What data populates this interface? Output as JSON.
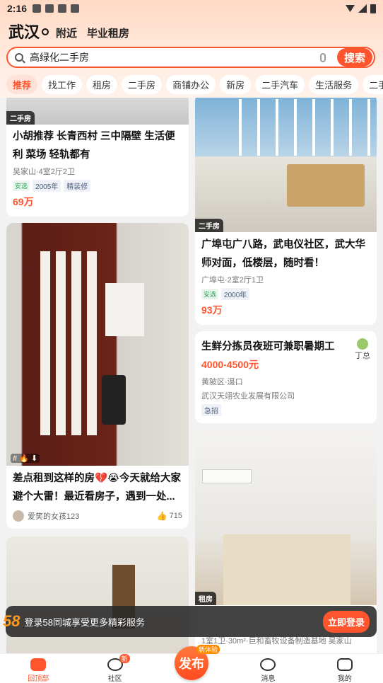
{
  "status_bar": {
    "time": "2:16"
  },
  "header": {
    "city": "武汉",
    "links": [
      "附近",
      "毕业租房"
    ]
  },
  "search": {
    "query": "高绿化二手房",
    "button": "搜索"
  },
  "tabs": [
    "推荐",
    "找工作",
    "租房",
    "二手房",
    "商铺办公",
    "新房",
    "二手汽车",
    "生活服务",
    "二手回"
  ],
  "feed": {
    "card1": {
      "tag": "二手房",
      "title": "小胡推荐 长青西村 三中隔壁 生活便利 菜场 轻轨都有",
      "meta": "吴家山·4室2厅2卫",
      "chips": [
        "安选",
        "2005年",
        "精装修"
      ],
      "price": "69万"
    },
    "card2": {
      "tag": "二手房",
      "title": "广埠屯广八路，武电仪社区，武大华师对面，低楼层，随时看！",
      "meta": "广埠屯·2室2厅1卫",
      "chips": [
        "安选",
        "2000年"
      ],
      "price": "93万"
    },
    "card3": {
      "title": "差点租到这样的房💔😭今天就给大家避个大雷！最近看房子，遇到一处...",
      "img_tags": "# 🔥 ⬇",
      "author": "爱笑的女孩123",
      "likes": "715"
    },
    "card4": {
      "title": "生鲜分拣员夜班可兼职暑期工",
      "salary": "4000-4500元",
      "location": "黄陂区·滠口",
      "company": "武汉天翊农业发展有限公司",
      "chip": "急招",
      "side_label": "丁总"
    },
    "card5": {
      "tag": "租房",
      "meta": "1室1卫·30m²·巨和畜牧设备制造基地 吴家山"
    }
  },
  "login_bar": {
    "logo": "58",
    "text": "登录58同城享受更多精彩服务",
    "button": "立即登录"
  },
  "bottom_nav": [
    {
      "label": "回顶部",
      "icon": "home-icon"
    },
    {
      "label": "社区",
      "icon": "planet-icon",
      "badge": "新"
    },
    {
      "label": "发布",
      "icon": "publish-icon",
      "badge": "新体验"
    },
    {
      "label": "消息",
      "icon": "message-icon"
    },
    {
      "label": "我的",
      "icon": "user-icon"
    }
  ],
  "colors": {
    "brand": "#ff552e"
  }
}
